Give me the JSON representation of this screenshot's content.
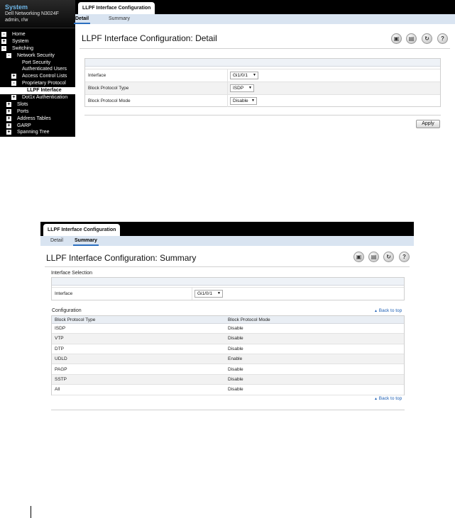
{
  "nav": {
    "title": "System",
    "device": "Dell Networking N3024F",
    "user": "admin, r/w",
    "items": [
      {
        "label": "Home",
        "exp": "-",
        "indent": 0
      },
      {
        "label": "System",
        "exp": "+",
        "indent": 0
      },
      {
        "label": "Switching",
        "exp": "-",
        "indent": 0
      },
      {
        "label": "Network Security",
        "exp": "-",
        "indent": 1
      },
      {
        "label": "Port Security",
        "exp": "",
        "indent": 2
      },
      {
        "label": "Authenticated Users",
        "exp": "",
        "indent": 2
      },
      {
        "label": "Access Control Lists",
        "exp": "+",
        "indent": 2
      },
      {
        "label": "Proprietary Protocol",
        "exp": "-",
        "indent": 2
      },
      {
        "label": "LLPF Interface",
        "exp": "",
        "indent": 3,
        "active": true
      },
      {
        "label": "Dot1x Authentication",
        "exp": "+",
        "indent": 2
      },
      {
        "label": "Slots",
        "exp": "+",
        "indent": 1
      },
      {
        "label": "Ports",
        "exp": "+",
        "indent": 1
      },
      {
        "label": "Address Tables",
        "exp": "+",
        "indent": 1
      },
      {
        "label": "GARP",
        "exp": "+",
        "indent": 1
      },
      {
        "label": "Spanning Tree",
        "exp": "+",
        "indent": 1
      }
    ]
  },
  "detail": {
    "tab_title": "LLPF Interface Configuration",
    "subtab_detail": "Detail",
    "subtab_summary": "Summary",
    "page_title": "LLPF Interface Configuration: Detail",
    "fields": {
      "interface_label": "Interface",
      "interface_value": "Gi1/0/1",
      "type_label": "Block Protocol Type",
      "type_value": "ISDP",
      "mode_label": "Block Protocol Mode",
      "mode_value": "Disable"
    },
    "apply_label": "Apply"
  },
  "summary": {
    "tab_title": "LLPF Interface Configuration",
    "subtab_detail": "Detail",
    "subtab_summary": "Summary",
    "page_title": "LLPF Interface Configuration: Summary",
    "selection_title": "Interface Selection",
    "interface_label": "Interface",
    "interface_value": "Gi1/0/1",
    "config_title": "Configuration",
    "back_to_top": "Back to top",
    "columns": [
      "Block Protocol Type",
      "Block Protocol Mode"
    ],
    "rows": [
      [
        "ISDP",
        "Disable"
      ],
      [
        "VTP",
        "Disable"
      ],
      [
        "DTP",
        "Disable"
      ],
      [
        "UDLD",
        "Enable"
      ],
      [
        "PAGP",
        "Disable"
      ],
      [
        "SSTP",
        "Disable"
      ],
      [
        "All",
        "Disable"
      ]
    ]
  },
  "icons": [
    "save-icon",
    "print-icon",
    "refresh-icon",
    "help-icon"
  ]
}
